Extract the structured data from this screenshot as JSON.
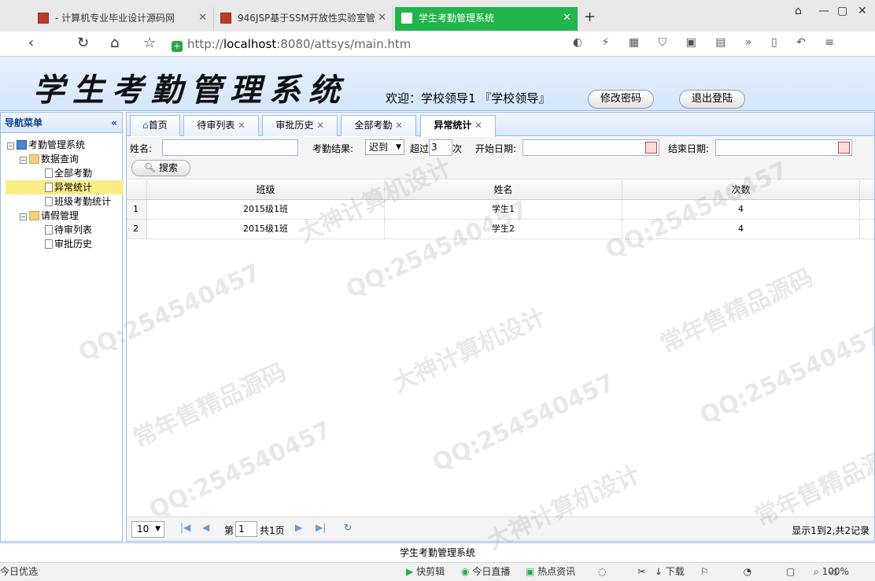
{
  "browser": {
    "tabs": [
      {
        "label": "- 计算机专业毕业设计源码网"
      },
      {
        "label": "946JSP基于SSM开放性实验室管"
      },
      {
        "label": "学生考勤管理系统"
      }
    ],
    "url_prefix": "http://",
    "url_host": "localhost",
    "url_rest": ":8080/attsys/main.htm"
  },
  "header": {
    "title": "学生考勤管理系统",
    "welcome": "欢迎：学校领导1 『学校领导』",
    "change_password": "修改密码",
    "logout": "退出登陆"
  },
  "sidebar": {
    "title": "导航菜单",
    "collapse_symbol": "«",
    "items": [
      {
        "label": "考勤管理系统"
      },
      {
        "label": "数据查询"
      },
      {
        "label": "全部考勤"
      },
      {
        "label": "异常统计"
      },
      {
        "label": "班级考勤统计"
      },
      {
        "label": "请假管理"
      },
      {
        "label": "待审列表"
      },
      {
        "label": "审批历史"
      }
    ]
  },
  "content_tabs": [
    {
      "label": "首页"
    },
    {
      "label": "待审列表"
    },
    {
      "label": "审批历史"
    },
    {
      "label": "全部考勤"
    },
    {
      "label": "异常统计"
    }
  ],
  "filters": {
    "name_label": "姓名:",
    "name_value": "",
    "result_label": "考勤结果:",
    "result_value": "迟到",
    "over_label": "超过",
    "over_value": "3",
    "times_unit": "次",
    "start_label": "开始日期:",
    "start_value": "",
    "end_label": "结束日期:",
    "end_value": "",
    "search": "搜索"
  },
  "grid": {
    "columns": [
      "班级",
      "姓名",
      "次数"
    ],
    "rows": [
      {
        "num": "1",
        "class": "2015级1班",
        "name": "学生1",
        "count": "4"
      },
      {
        "num": "2",
        "class": "2015级1班",
        "name": "学生2",
        "count": "4"
      }
    ]
  },
  "pager": {
    "page_size": "10",
    "page_prefix": "第",
    "page_value": "1",
    "page_suffix": "共1页",
    "info": "显示1到2,共2记录"
  },
  "footer": "学生考勤管理系统",
  "statusbar": {
    "left": "今日优选",
    "items": [
      "快剪辑",
      "今日直播",
      "热点资讯",
      "下载",
      "100%"
    ]
  },
  "watermarks": [
    "QQ:254540457",
    "常年售精品源码",
    "大神计算机设计"
  ]
}
